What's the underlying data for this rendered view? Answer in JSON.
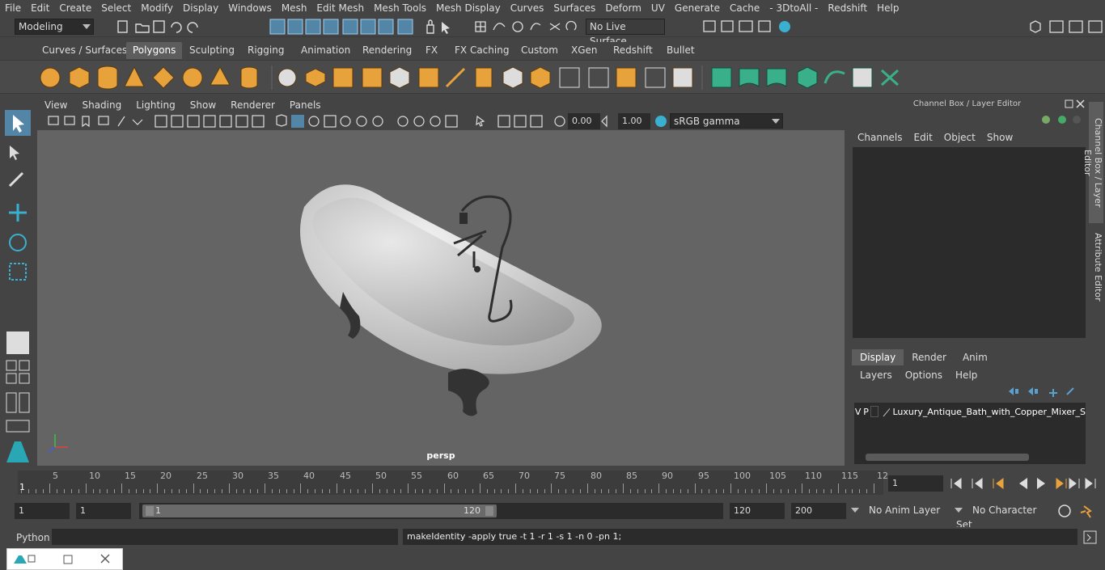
{
  "menu": [
    "File",
    "Edit",
    "Create",
    "Select",
    "Modify",
    "Display",
    "Windows",
    "Mesh",
    "Edit Mesh",
    "Mesh Tools",
    "Mesh Display",
    "Curves",
    "Surfaces",
    "Deform",
    "UV",
    "Generate",
    "Cache",
    "- 3DtoAll -",
    "Redshift",
    "Help"
  ],
  "status": {
    "workspace": "Modeling",
    "live_surface": "No Live Surface"
  },
  "shelf_tabs": [
    "Curves / Surfaces",
    "Polygons",
    "Sculpting",
    "Rigging",
    "Animation",
    "Rendering",
    "FX",
    "FX Caching",
    "Custom",
    "XGen",
    "Redshift",
    "Bullet"
  ],
  "shelf_active": "Polygons",
  "panel_menu": [
    "View",
    "Shading",
    "Lighting",
    "Show",
    "Renderer",
    "Panels"
  ],
  "panel_tools": {
    "exposure": "0.00",
    "gamma": "1.00",
    "colorspace": "sRGB gamma"
  },
  "viewport": {
    "camera": "persp"
  },
  "channel_box": {
    "title": "Channel Box / Layer Editor",
    "menu": [
      "Channels",
      "Edit",
      "Object",
      "Show"
    ],
    "layer_tabs": [
      "Display",
      "Render",
      "Anim"
    ],
    "layer_menu": [
      "Layers",
      "Options",
      "Help"
    ],
    "layer": {
      "v": "V",
      "p": "P",
      "name": "Luxury_Antique_Bath_with_Copper_Mixer_S"
    }
  },
  "side_tabs": [
    "Channel Box / Layer Editor",
    "Attribute Editor"
  ],
  "timeline": {
    "ticks": [
      "5",
      "10",
      "15",
      "20",
      "25",
      "30",
      "35",
      "40",
      "45",
      "50",
      "55",
      "60",
      "65",
      "70",
      "75",
      "80",
      "85",
      "90",
      "95",
      "100",
      "105",
      "110",
      "115",
      "12"
    ],
    "start_label": "1",
    "current_frame": "1"
  },
  "range": {
    "start": "1",
    "playback_start": "1",
    "slider_start": "1",
    "slider_end": "120",
    "playback_end": "120",
    "end": "200",
    "anim_layer": "No Anim Layer",
    "char_set": "No Character Set"
  },
  "cmd": {
    "lang": "Python",
    "result": "makeIdentity -apply true -t 1 -r 1 -s 1 -n 0 -pn 1;"
  },
  "colors": {
    "accent": "#5285a6",
    "shelf_orange": "#e8a23c",
    "shelf_teal": "#3ab08a",
    "maya_logo": "#2aa7b5"
  }
}
